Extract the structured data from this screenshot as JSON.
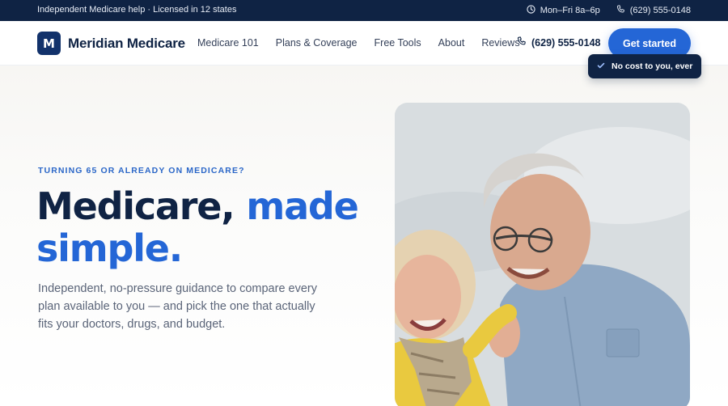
{
  "topbar": {
    "tagline": "Independent Medicare help · Licensed in 12 states",
    "hours": "Mon–Fri 8a–6p",
    "phone": "(629) 555-0148"
  },
  "header": {
    "brand_mark": "M",
    "brand_name": "Meridian Medicare",
    "nav": [
      "Medicare 101",
      "Plans & Coverage",
      "Free Tools",
      "About",
      "Reviews"
    ],
    "phone": "(629) 555-0148",
    "cta_label": "Get started"
  },
  "hero": {
    "eyebrow": "TURNING 65 OR ALREADY ON MEDICARE?",
    "headline_part1": "Medicare, ",
    "headline_accent": "made simple.",
    "lede": "Independent, no-pressure guidance to compare every plan available to you — and pick the one that actually fits your doctors, drugs, and budget.",
    "badge": "No cost to you, ever"
  },
  "icons": {
    "clock": "clock-icon",
    "phone": "phone-icon",
    "check": "check-icon"
  },
  "colors": {
    "navy": "#0f2344",
    "accent": "#2466d6"
  }
}
